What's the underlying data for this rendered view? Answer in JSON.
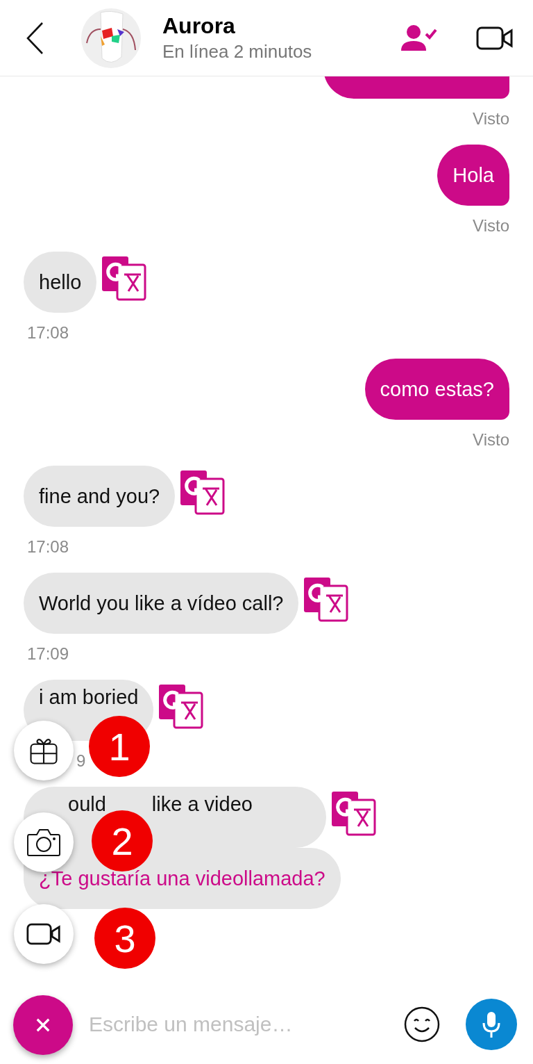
{
  "header": {
    "name": "Aurora",
    "status": "En línea 2 minutos"
  },
  "messages": [
    {
      "kind": "out",
      "meta": "Visto"
    },
    {
      "kind": "out",
      "text": "Hola",
      "meta": "Visto"
    },
    {
      "kind": "in",
      "text": "hello",
      "translate": true,
      "meta": "17:08"
    },
    {
      "kind": "out",
      "text": "como estas?",
      "meta": "Visto"
    },
    {
      "kind": "in",
      "text": "fine and you?",
      "translate": true,
      "meta": "17:08"
    },
    {
      "kind": "in",
      "text": "World you like a vídeo call?",
      "translate": true,
      "meta": "17:09"
    },
    {
      "kind": "in",
      "text": "i am boried",
      "translate": true,
      "meta": "9",
      "covered": true
    },
    {
      "kind": "in",
      "parts": [
        "ould",
        "like a video"
      ],
      "translate": true,
      "covered": true
    },
    {
      "kind": "translation",
      "text": "¿Te gustaría una videollamada?"
    }
  ],
  "fab_menu": [
    {
      "kind": "gift"
    },
    {
      "kind": "camera"
    },
    {
      "kind": "video"
    }
  ],
  "annotations": [
    "1",
    "2",
    "3"
  ],
  "composer": {
    "placeholder": "Escribe un mensaje…"
  }
}
